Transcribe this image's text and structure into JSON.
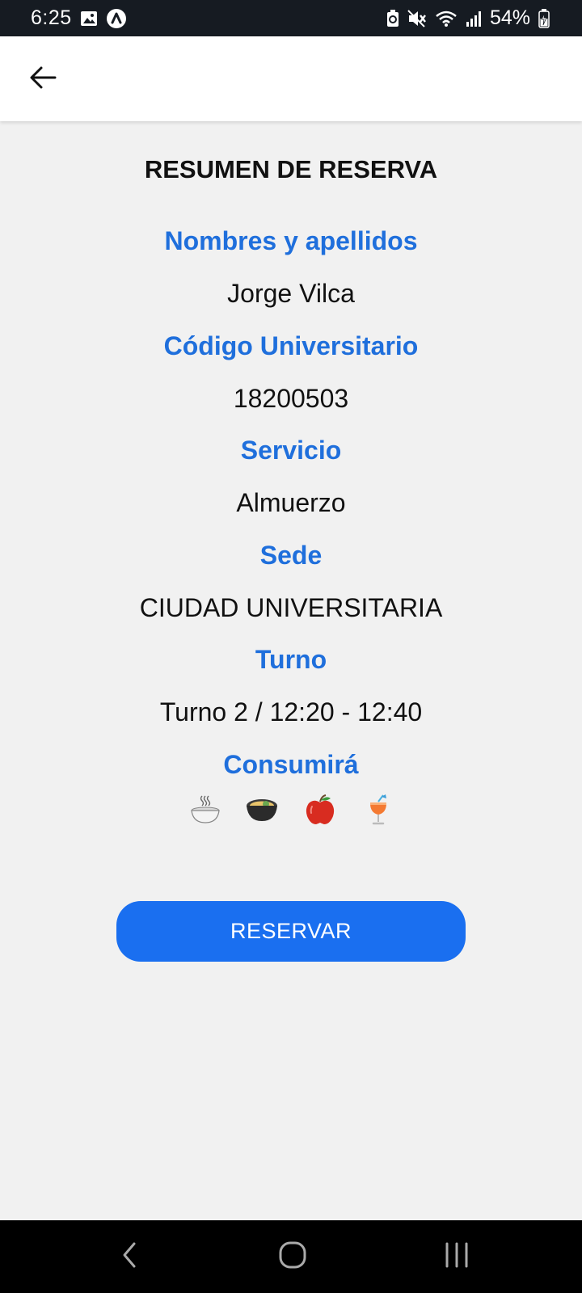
{
  "status_bar": {
    "time": "6:25",
    "battery_percent": "54%",
    "icons_left": [
      "image-icon",
      "app-notification-icon"
    ],
    "icons_right": [
      "battery-saver-icon",
      "mute-icon",
      "wifi-icon",
      "signal-icon",
      "battery-charging-icon"
    ]
  },
  "app_bar": {
    "back_icon": "arrow-left-icon"
  },
  "summary": {
    "title": "RESUMEN DE RESERVA",
    "fields": [
      {
        "label": "Nombres y apellidos",
        "value": "Jorge Vilca"
      },
      {
        "label": "Código Universitario",
        "value": "18200503"
      },
      {
        "label": "Servicio",
        "value": "Almuerzo"
      },
      {
        "label": "Sede",
        "value": "CIUDAD UNIVERSITARIA"
      },
      {
        "label": "Turno",
        "value": "Turno 2 / 12:20 - 12:40"
      }
    ],
    "consume_label": "Consumirá",
    "consume_icons": [
      "hot-soup-bowl-icon",
      "main-dish-bowl-icon",
      "apple-icon",
      "drink-icon"
    ]
  },
  "actions": {
    "reserve_label": "RESERVAR"
  },
  "colors": {
    "accent": "#1f6fdc",
    "button": "#1a6ff0",
    "background": "#f1f1f1",
    "status_bar": "#161b22"
  },
  "nav_bar": {
    "icons": [
      "nav-back-icon",
      "nav-home-icon",
      "nav-recents-icon"
    ]
  }
}
